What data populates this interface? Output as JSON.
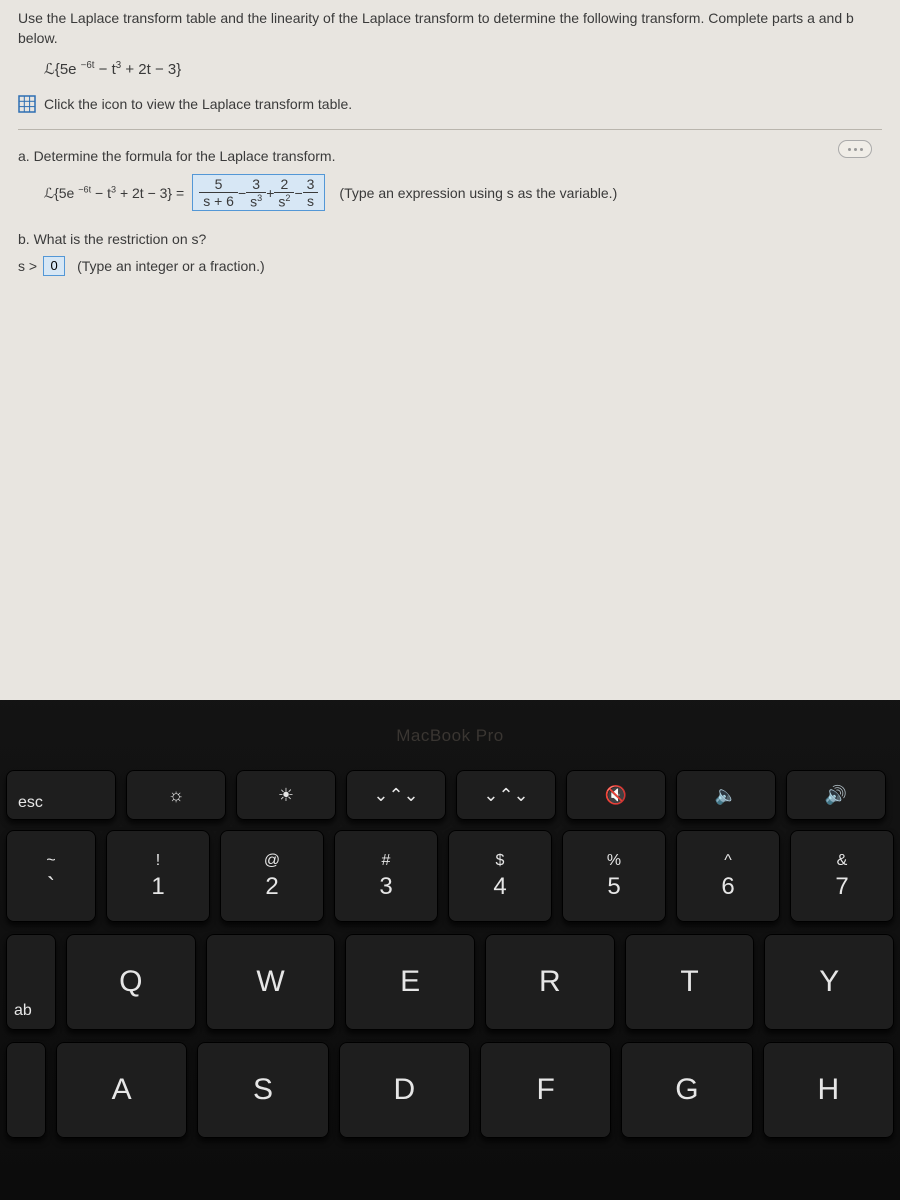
{
  "problem": {
    "prompt": "Use the Laplace transform table and the linearity of the Laplace transform to determine the following transform. Complete parts a and b below.",
    "expression_html": "ℒ{5e <sup>−6t</sup> − t<sup>3</sup> + 2t − 3}",
    "table_link": "Click the icon to view the Laplace transform table.",
    "part_a": {
      "label": "a. Determine the formula for the Laplace transform.",
      "lhs_html": "ℒ{5e <sup>−6t</sup> − t<sup>3</sup> + 2t − 3} =",
      "answer": {
        "terms": [
          {
            "num": "5",
            "den": "s + 6",
            "sign": ""
          },
          {
            "num": "3",
            "den": "s<sup>3</sup>",
            "sign": "−"
          },
          {
            "num": "2",
            "den": "s<sup>2</sup>",
            "sign": "+"
          },
          {
            "num": "3",
            "den": "s",
            "sign": "−"
          }
        ]
      },
      "hint": "(Type an expression using s as the variable.)"
    },
    "part_b": {
      "label": "b. What is the restriction on s?",
      "prefix": "s >",
      "value": "0",
      "hint": "(Type an integer or a fraction.)"
    }
  },
  "hardware": {
    "brand": "MacBook Pro",
    "function_row": [
      {
        "name": "esc",
        "label": "esc",
        "icon": ""
      },
      {
        "name": "dimmer",
        "label": "",
        "icon": "☼"
      },
      {
        "name": "brighter",
        "label": "",
        "icon": "☀"
      },
      {
        "name": "mission",
        "label": "",
        "icon": "⌄⌃⌄"
      },
      {
        "name": "spotlight",
        "label": "",
        "icon": "⌄⌃⌄"
      },
      {
        "name": "mute",
        "label": "",
        "icon": "🔇"
      },
      {
        "name": "voldown",
        "label": "",
        "icon": "🔈"
      },
      {
        "name": "volup",
        "label": "",
        "icon": "🔊"
      }
    ],
    "number_row": [
      {
        "upper": "~",
        "lower": "`"
      },
      {
        "upper": "!",
        "lower": "1"
      },
      {
        "upper": "@",
        "lower": "2"
      },
      {
        "upper": "#",
        "lower": "3"
      },
      {
        "upper": "$",
        "lower": "4"
      },
      {
        "upper": "%",
        "lower": "5"
      },
      {
        "upper": "^",
        "lower": "6"
      },
      {
        "upper": "&",
        "lower": "7"
      }
    ],
    "qwerty_row": {
      "tab": "ab",
      "keys": [
        "Q",
        "W",
        "E",
        "R",
        "T",
        "Y"
      ]
    },
    "asdf_row": {
      "keys": [
        "A",
        "S",
        "D",
        "F",
        "G",
        "H"
      ]
    }
  }
}
